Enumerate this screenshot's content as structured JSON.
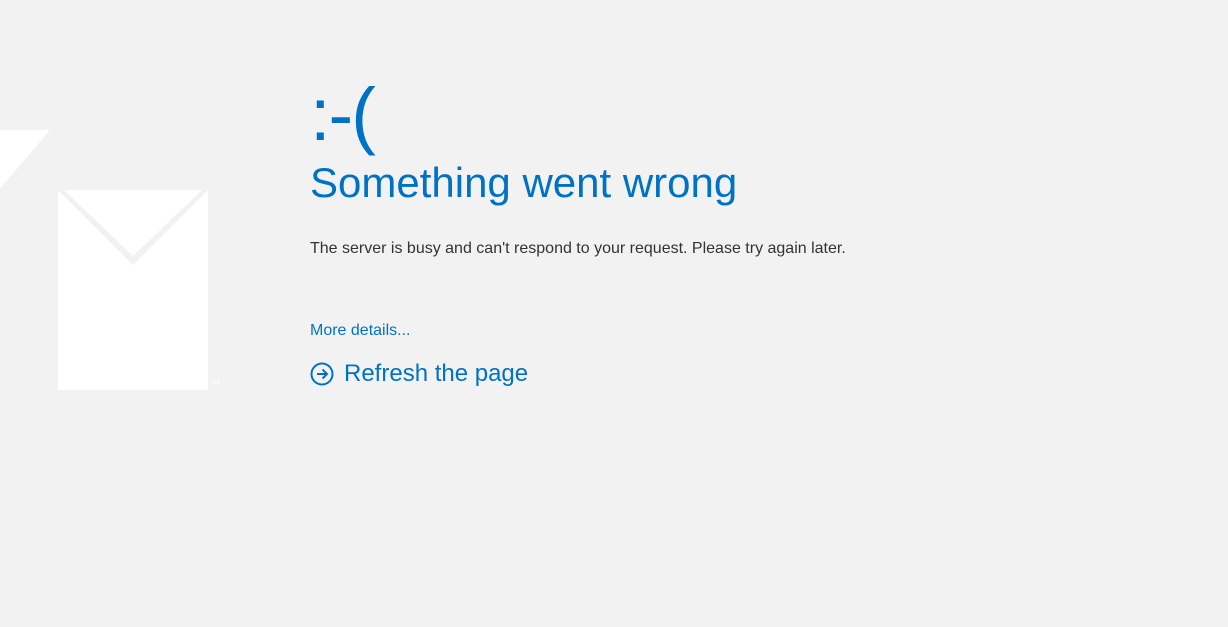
{
  "error": {
    "emoticon": ":-(",
    "heading": "Something went wrong",
    "message": "The server is busy and can't respond to your request. Please try again later.",
    "more_details_label": "More details...",
    "refresh_label": "Refresh the page"
  },
  "colors": {
    "accent": "#0072c6",
    "background": "#f2f2f2",
    "text": "#333333",
    "watermark": "#ffffff"
  }
}
